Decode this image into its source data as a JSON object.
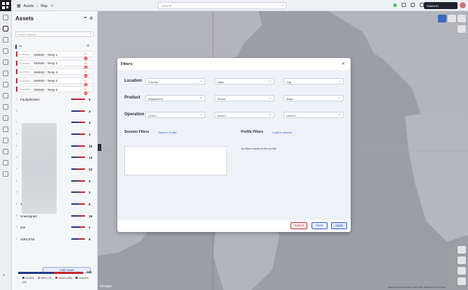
{
  "topbar": {
    "breadcrumb": [
      "Assets",
      "Map"
    ],
    "search_placeholder": "Search",
    "user_label": "PAMURO"
  },
  "panel": {
    "title": "Assets",
    "search_placeholder": "Search assets",
    "tag_label": "Ski",
    "assets": [
      {
        "id": "IS-0000041",
        "name": "EMS02 - Temp 1"
      },
      {
        "id": "IS-0000042",
        "name": "EMS02 - Temp 2"
      },
      {
        "id": "IS-0000043",
        "name": "EMS02 - Temp 3"
      },
      {
        "id": "IS-0000044",
        "name": "EMS02 - Temp 4"
      },
      {
        "id": "IS-0000045",
        "name": "EMS02 - Temp 5"
      }
    ],
    "groups": [
      {
        "name": "Faulty/Broken",
        "count": "5",
        "fill": 0.1
      },
      {
        "name": "",
        "count": "3",
        "fill": 0.6
      },
      {
        "name": "",
        "count": "3",
        "fill": 0.55
      },
      {
        "name": "",
        "count": "3",
        "fill": 0.6
      },
      {
        "name": "",
        "count": "10",
        "fill": 0.5
      },
      {
        "name": "",
        "count": "14",
        "fill": 0.45
      },
      {
        "name": "",
        "count": "23",
        "fill": 0.4
      },
      {
        "name": "",
        "count": "0",
        "fill": 0.5
      },
      {
        "name": "",
        "count": "2",
        "fill": 0.5
      },
      {
        "name": "Team Devices",
        "count": "9",
        "fill": 0.55
      },
      {
        "name": "Unassigned",
        "count": "18",
        "fill": 0.5
      },
      {
        "name": "test",
        "count": "1",
        "fill": 0.6
      },
      {
        "name": "ADELETE",
        "count": "6",
        "fill": 0.5
      }
    ],
    "add_asset_label": "Add Asset",
    "total_count": "181",
    "total_fill": 0.55,
    "legend": [
      {
        "label": "Off (580)",
        "color": "#1f3a8a"
      },
      {
        "label": "Offline (75)",
        "color": "#888888"
      },
      {
        "label": "Passive (506)",
        "color": "#c1272d"
      },
      {
        "label": "NoDevice (25)",
        "color": "#333333"
      }
    ]
  },
  "map": {
    "google_label": "Google",
    "footer": "Keyboard shortcuts  Map data ©2023 Google, INEGI  200 km  Terms of Use"
  },
  "filters": {
    "title": "Filters",
    "rows": [
      {
        "label": "Location",
        "selects": [
          "Country",
          "State",
          "City"
        ]
      },
      {
        "label": "Product",
        "selects": [
          "Assignment",
          "Device",
          "Make"
        ]
      },
      {
        "label": "Operation",
        "selects": [
          "Level 1",
          "Level 2",
          "Level 3"
        ]
      }
    ],
    "session_title": "Session Filters",
    "session_link": "Save to Profile",
    "profile_title": "Profile Filters",
    "profile_link": "Load to session",
    "profile_empty": "No filters saved to the profile",
    "buttons": {
      "cancel": "Cancel",
      "clear": "Clear",
      "apply": "Apply"
    }
  },
  "colors": {
    "accent": "#2a5ad0",
    "alert": "#c1272d",
    "navy": "#1f3a8a"
  }
}
